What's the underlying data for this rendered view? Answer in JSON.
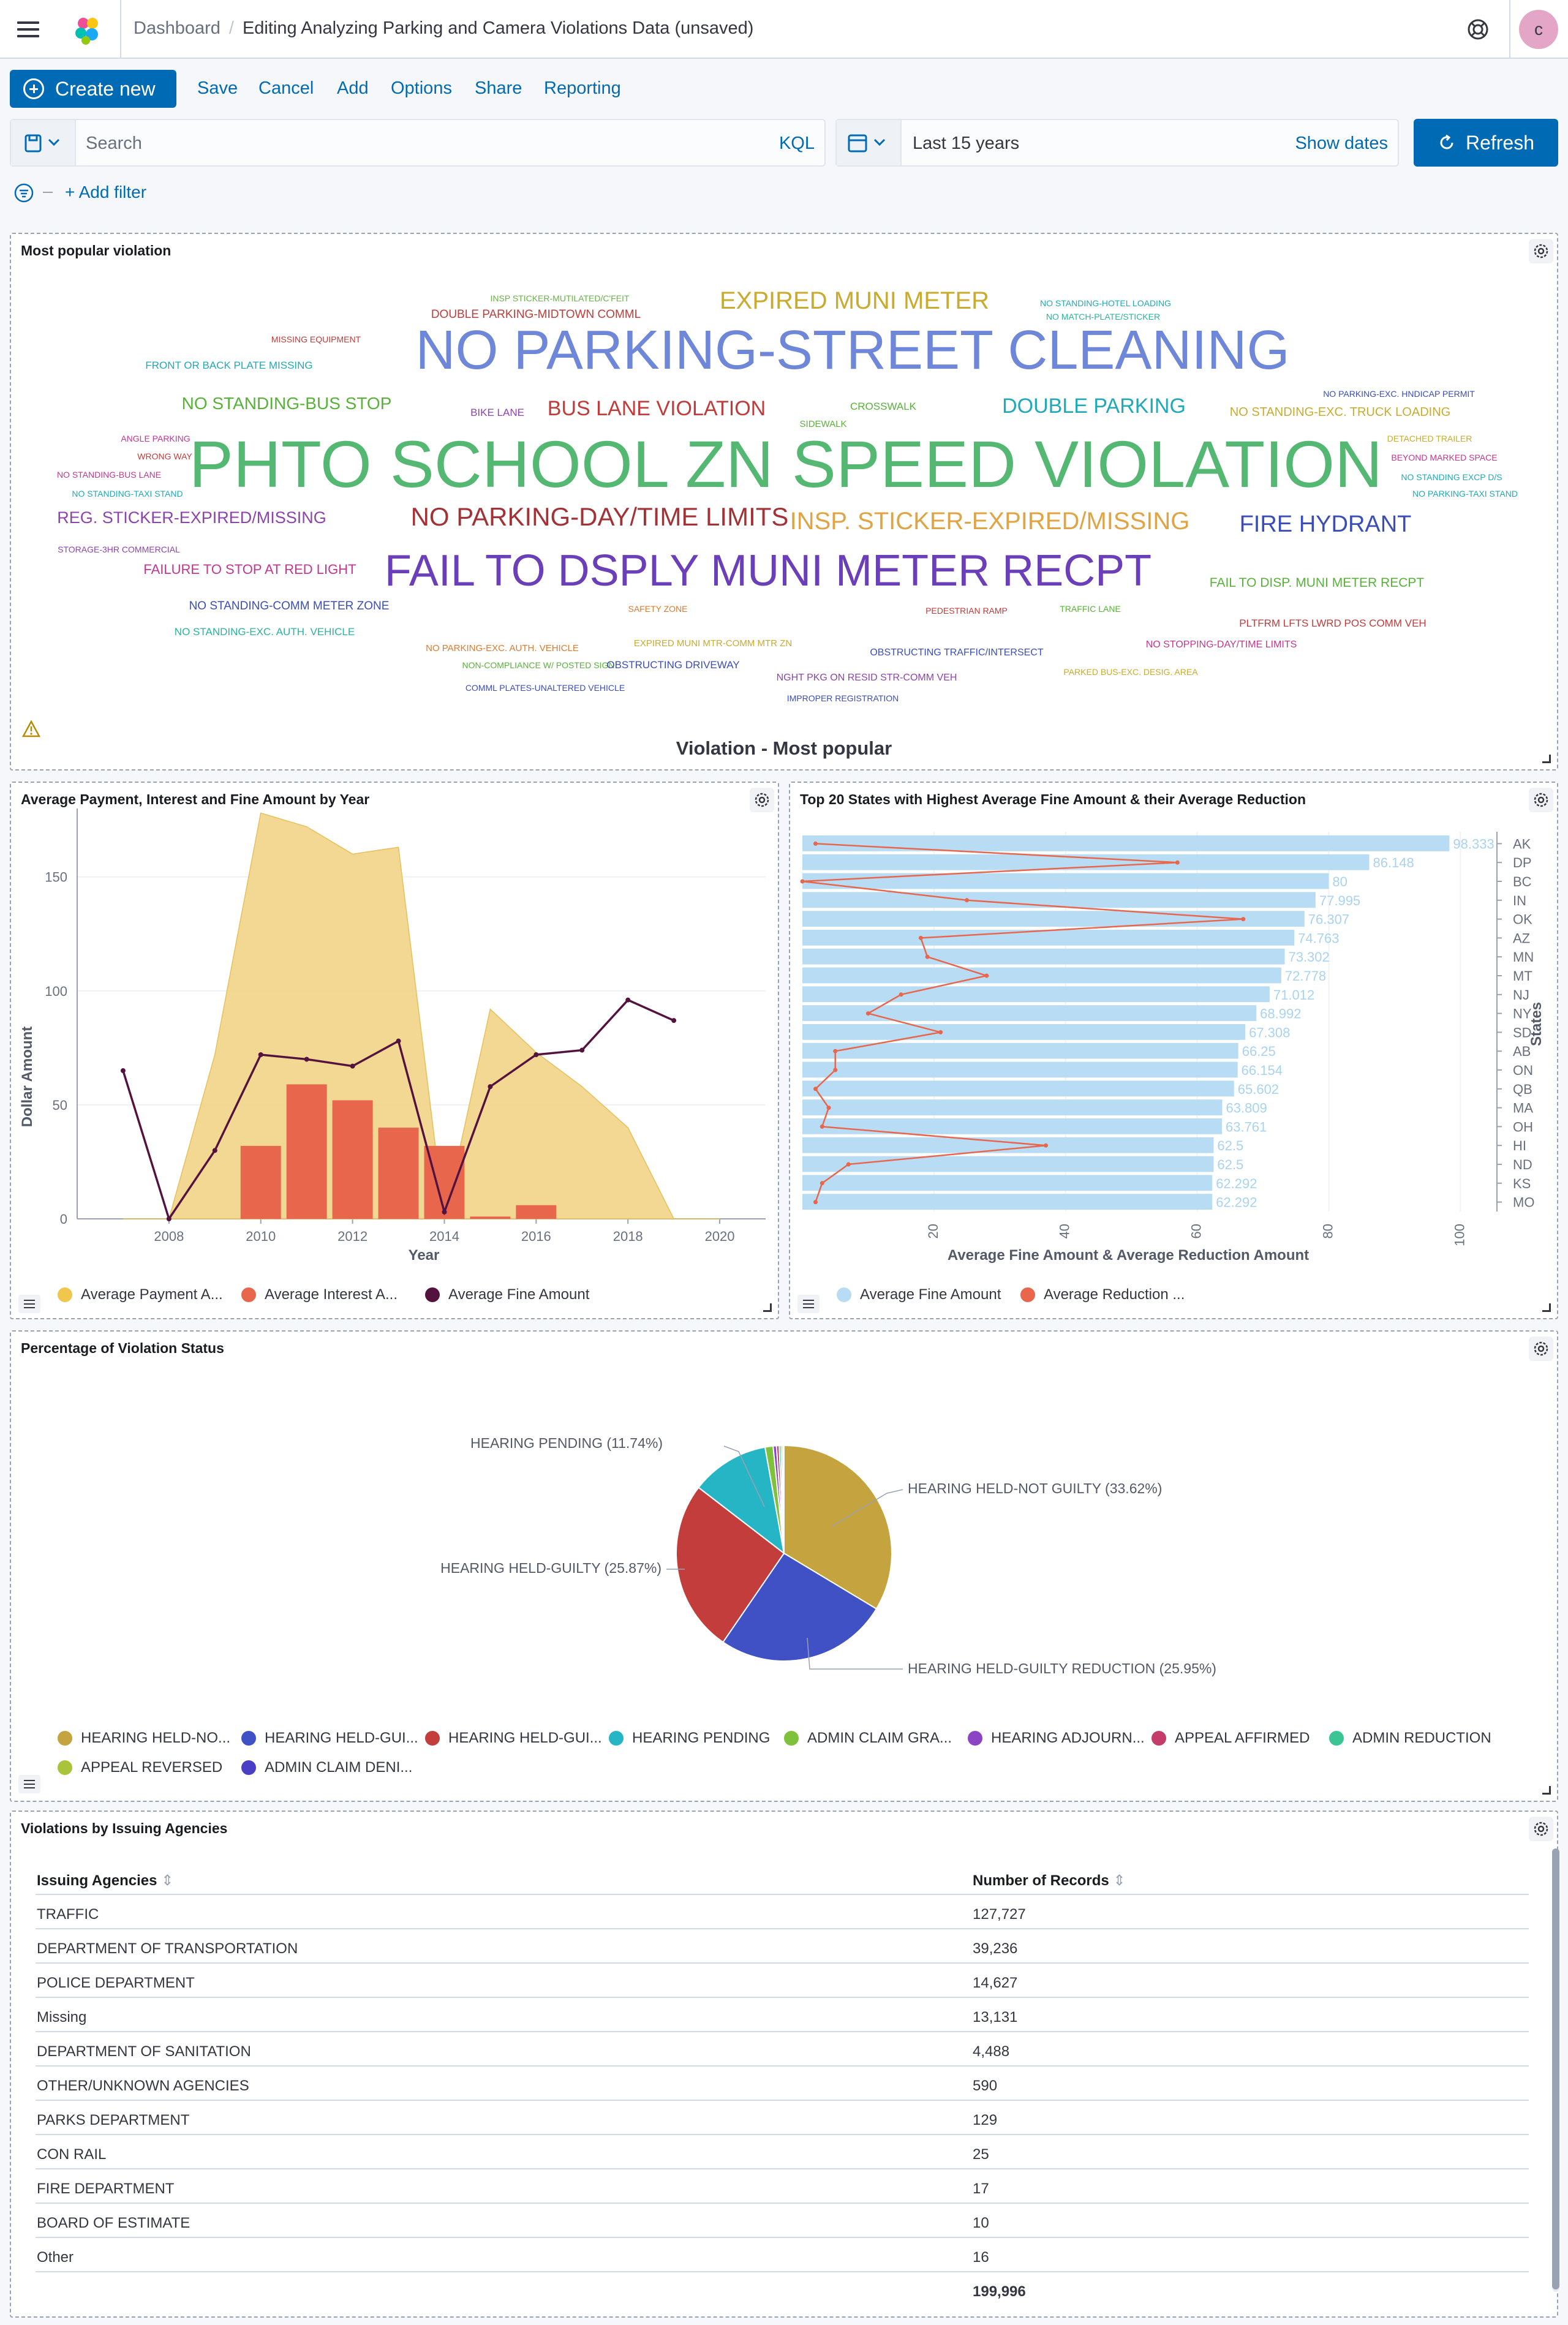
{
  "header": {
    "breadcrumb_root": "Dashboard",
    "breadcrumb_current": "Editing Analyzing Parking and Camera Violations Data (unsaved)",
    "avatar_initial": "c"
  },
  "menu": {
    "create_new": "Create new",
    "items": [
      "Save",
      "Cancel",
      "Add",
      "Options",
      "Share",
      "Reporting"
    ]
  },
  "query": {
    "search_placeholder": "Search",
    "language": "KQL",
    "time_range": "Last 15 years",
    "show_dates": "Show dates",
    "refresh": "Refresh",
    "add_filter": "+ Add filter"
  },
  "colors": {
    "primary": "#006bb4",
    "yellow": "#f1d486",
    "red": "#e7664c",
    "purple": "#54123f",
    "lightblue": "#b8dcf4"
  },
  "panels": {
    "wordcloud": {
      "title": "Most popular violation",
      "caption": "Violation - Most popular",
      "words": [
        {
          "text": "INSP STICKER-MUTILATED/C'FEIT",
          "size": 14,
          "color": "#6ab04c"
        },
        {
          "text": "DOUBLE PARKING-MIDTOWN COMML",
          "size": 19,
          "color": "#c23b3b"
        },
        {
          "text": "EXPIRED MUNI METER",
          "size": 40,
          "color": "#c9ab2f"
        },
        {
          "text": "NO STANDING-HOTEL LOADING",
          "size": 14,
          "color": "#20a9b8"
        },
        {
          "text": "NO MATCH-PLATE/STICKER",
          "size": 14,
          "color": "#2ab39d"
        },
        {
          "text": "MISSING EQUIPMENT",
          "size": 14,
          "color": "#c23b3b"
        },
        {
          "text": "NO PARKING-STREET CLEANING",
          "size": 90,
          "color": "#6f87d8"
        },
        {
          "text": "FRONT OR BACK PLATE MISSING",
          "size": 17,
          "color": "#20a9b8"
        },
        {
          "text": "NO STANDING-BUS STOP",
          "size": 28,
          "color": "#58b23a"
        },
        {
          "text": "BIKE LANE",
          "size": 17,
          "color": "#8e44ad"
        },
        {
          "text": "BUS LANE VIOLATION",
          "size": 34,
          "color": "#c23b3b"
        },
        {
          "text": "CROSSWALK",
          "size": 17,
          "color": "#58b23a"
        },
        {
          "text": "DOUBLE PARKING",
          "size": 34,
          "color": "#20a9b8"
        },
        {
          "text": "NO STANDING-EXC. TRUCK LOADING",
          "size": 20,
          "color": "#c9ab2f"
        },
        {
          "text": "NO PARKING-EXC. HNDICAP PERMIT",
          "size": 14,
          "color": "#3b4db8"
        },
        {
          "text": "SIDEWALK",
          "size": 15,
          "color": "#58b23a"
        },
        {
          "text": "ANGLE PARKING",
          "size": 14,
          "color": "#c2368f"
        },
        {
          "text": "DETACHED TRAILER",
          "size": 14,
          "color": "#c9ab2f"
        },
        {
          "text": "WRONG WAY",
          "size": 14,
          "color": "#c23b3b"
        },
        {
          "text": "PHTO SCHOOL ZN SPEED VIOLATION",
          "size": 108,
          "color": "#54b873"
        },
        {
          "text": "BEYOND MARKED SPACE",
          "size": 14,
          "color": "#c2368f"
        },
        {
          "text": "NO STANDING-BUS LANE",
          "size": 14,
          "color": "#c2368f"
        },
        {
          "text": "NO STANDING EXCP D/S",
          "size": 14,
          "color": "#20a9b8"
        },
        {
          "text": "NO STANDING-TAXI STAND",
          "size": 14,
          "color": "#20a9b8"
        },
        {
          "text": "NO PARKING-TAXI STAND",
          "size": 14,
          "color": "#20a9b8"
        },
        {
          "text": "REG. STICKER-EXPIRED/MISSING",
          "size": 27,
          "color": "#8e44ad"
        },
        {
          "text": "NO PARKING-DAY/TIME LIMITS",
          "size": 42,
          "color": "#a33236"
        },
        {
          "text": "INSP. STICKER-EXPIRED/MISSING",
          "size": 40,
          "color": "#e0a445"
        },
        {
          "text": "FIRE HYDRANT",
          "size": 38,
          "color": "#3b4db8"
        },
        {
          "text": "STORAGE-3HR COMMERCIAL",
          "size": 14,
          "color": "#8e44ad"
        },
        {
          "text": "FAILURE TO STOP AT RED LIGHT",
          "size": 22,
          "color": "#c2368f"
        },
        {
          "text": "FAIL TO DSPLY MUNI METER RECPT",
          "size": 72,
          "color": "#6a3fb8"
        },
        {
          "text": "FAIL TO DISP. MUNI METER RECPT",
          "size": 21,
          "color": "#58b23a"
        },
        {
          "text": "NO STANDING-COMM METER ZONE",
          "size": 19,
          "color": "#3b4db8"
        },
        {
          "text": "SAFETY ZONE",
          "size": 14,
          "color": "#e07a2f"
        },
        {
          "text": "PEDESTRIAN RAMP",
          "size": 14,
          "color": "#c23b3b"
        },
        {
          "text": "TRAFFIC LANE",
          "size": 14,
          "color": "#58b23a"
        },
        {
          "text": "PLTFRM LFTS LWRD POS COMM VEH",
          "size": 17,
          "color": "#c23b3b"
        },
        {
          "text": "NO STANDING-EXC. AUTH. VEHICLE",
          "size": 17,
          "color": "#2ab39d"
        },
        {
          "text": "NO PARKING-EXC. AUTH. VEHICLE",
          "size": 15,
          "color": "#e07a2f"
        },
        {
          "text": "EXPIRED MUNI MTR-COMM MTR ZN",
          "size": 15,
          "color": "#c9ab2f"
        },
        {
          "text": "OBSTRUCTING TRAFFIC/INTERSECT",
          "size": 16,
          "color": "#3b4db8"
        },
        {
          "text": "NO STOPPING-DAY/TIME LIMITS",
          "size": 16,
          "color": "#c2368f"
        },
        {
          "text": "NON-COMPLIANCE W/ POSTED SIGN",
          "size": 14,
          "color": "#58b23a"
        },
        {
          "text": "OBSTRUCTING DRIVEWAY",
          "size": 17,
          "color": "#3b4db8"
        },
        {
          "text": "NGHT PKG ON RESID STR-COMM VEH",
          "size": 16,
          "color": "#8e44ad"
        },
        {
          "text": "PARKED BUS-EXC. DESIG. AREA",
          "size": 14,
          "color": "#c9ab2f"
        },
        {
          "text": "COMML PLATES-UNALTERED VEHICLE",
          "size": 14,
          "color": "#3b4db8"
        },
        {
          "text": "IMPROPER REGISTRATION",
          "size": 14,
          "color": "#3b4db8"
        }
      ]
    },
    "yearly": {
      "title": "Average Payment, Interest and Fine Amount by Year",
      "xlabel": "Year",
      "ylabel": "Dollar Amount",
      "legend": [
        "Average Payment A...",
        "Average Interest A...",
        "Average Fine Amount"
      ]
    },
    "states": {
      "title": "Top 20 States with Highest Average Fine Amount & their Average Reduction",
      "xlabel": "Average Fine Amount & Average Reduction Amount",
      "ylabel": "States",
      "legend": [
        "Average Fine Amount",
        "Average Reduction ..."
      ]
    },
    "status": {
      "title": "Percentage of Violation Status",
      "legend": [
        "HEARING HELD-NO...",
        "HEARING HELD-GUI...",
        "HEARING HELD-GUI...",
        "HEARING PENDING",
        "ADMIN CLAIM GRA...",
        "HEARING ADJOURN...",
        "APPEAL AFFIRMED",
        "ADMIN REDUCTION",
        "APPEAL REVERSED",
        "ADMIN CLAIM DENI..."
      ],
      "legend_colors": [
        "#c5a43f",
        "#3f51c4",
        "#c43d3d",
        "#25b5c4",
        "#7fc13b",
        "#8c44c4",
        "#c43d6a",
        "#3bc494",
        "#a9c43b",
        "#4a3fc4"
      ]
    },
    "agencies": {
      "title": "Violations by Issuing Agencies",
      "col_agency": "Issuing Agencies",
      "col_records": "Number of Records",
      "rows": [
        [
          "TRAFFIC",
          "127,727"
        ],
        [
          "DEPARTMENT OF TRANSPORTATION",
          "39,236"
        ],
        [
          "POLICE DEPARTMENT",
          "14,627"
        ],
        [
          "Missing",
          "13,131"
        ],
        [
          "DEPARTMENT OF SANITATION",
          "4,488"
        ],
        [
          "OTHER/UNKNOWN AGENCIES",
          "590"
        ],
        [
          "PARKS DEPARTMENT",
          "129"
        ],
        [
          "CON RAIL",
          "25"
        ],
        [
          "FIRE DEPARTMENT",
          "17"
        ],
        [
          "BOARD OF ESTIMATE",
          "10"
        ],
        [
          "Other",
          "16"
        ]
      ],
      "total": "199,996"
    }
  },
  "chart_data": [
    {
      "type": "area",
      "x": [
        2007,
        2008,
        2009,
        2010,
        2011,
        2012,
        2013,
        2014,
        2015,
        2016,
        2017,
        2018,
        2019,
        2020
      ],
      "xlim": [
        2006,
        2021
      ],
      "ylim": [
        0,
        180
      ],
      "yticks": [
        0,
        50,
        100,
        150
      ],
      "xticks": [
        2008,
        2010,
        2012,
        2014,
        2016,
        2018,
        2020
      ],
      "series": [
        {
          "name": "Average Payment A...",
          "kind": "area",
          "color": "#f1d486",
          "x": [
            2007,
            2008,
            2009,
            2010,
            2011,
            2012,
            2013,
            2014,
            2015,
            2016,
            2017,
            2018,
            2019,
            2020
          ],
          "values": [
            0,
            0,
            72,
            178,
            172,
            160,
            163,
            0,
            92,
            73,
            58,
            40,
            0,
            0
          ]
        },
        {
          "name": "Average Interest A...",
          "kind": "bar",
          "color": "#e7664c",
          "x": [
            2010,
            2011,
            2012,
            2013,
            2014,
            2015,
            2016
          ],
          "values": [
            32,
            59,
            52,
            40,
            32,
            1,
            6
          ]
        },
        {
          "name": "Average Fine Amount",
          "kind": "line",
          "color": "#54123f",
          "x": [
            2007,
            2008,
            2009,
            2010,
            2011,
            2012,
            2013,
            2014,
            2015,
            2016,
            2017,
            2018,
            2019
          ],
          "values": [
            65,
            0,
            30,
            72,
            70,
            67,
            78,
            3,
            58,
            72,
            74,
            96,
            87
          ]
        }
      ]
    },
    {
      "type": "bar",
      "orientation": "horizontal",
      "categories": [
        "AK",
        "DP",
        "BC",
        "IN",
        "OK",
        "AZ",
        "MN",
        "MT",
        "NJ",
        "NY",
        "SD",
        "AB",
        "ON",
        "QB",
        "MA",
        "OH",
        "HI",
        "ND",
        "KS",
        "MO"
      ],
      "xlim": [
        0,
        105
      ],
      "xticks": [
        20,
        40,
        60,
        80,
        100
      ],
      "series": [
        {
          "name": "Average Fine Amount",
          "kind": "bar",
          "color": "#b8dcf4",
          "values": [
            98.333,
            86.148,
            80,
            77.995,
            76.307,
            74.763,
            73.302,
            72.778,
            71.012,
            68.992,
            67.308,
            66.25,
            66.154,
            65.602,
            63.809,
            63.761,
            62.5,
            62.5,
            62.292,
            62.292
          ]
        },
        {
          "name": "Average Reduction ...",
          "kind": "line",
          "color": "#e7664c",
          "values": [
            2,
            57,
            0,
            25,
            67,
            18,
            19,
            28,
            15,
            10,
            21,
            5,
            5,
            2,
            4,
            3,
            37,
            7,
            3,
            2
          ]
        }
      ]
    },
    {
      "type": "pie",
      "labels": [
        "HEARING HELD-NOT GUILTY",
        "HEARING HELD-GUILTY REDUCTION",
        "HEARING HELD-GUILTY",
        "HEARING PENDING",
        "ADMIN CLAIM GRA...",
        "HEARING ADJOURN...",
        "APPEAL AFFIRMED",
        "ADMIN REDUCTION",
        "APPEAL REVERSED",
        "ADMIN CLAIM DENI..."
      ],
      "values": [
        33.62,
        25.95,
        25.87,
        11.74,
        1.2,
        0.5,
        0.4,
        0.3,
        0.25,
        0.17
      ],
      "colors": [
        "#c5a43f",
        "#3f51c4",
        "#c43d3d",
        "#25b5c4",
        "#7fc13b",
        "#8c44c4",
        "#c43d6a",
        "#3bc494",
        "#a9c43b",
        "#4a3fc4"
      ],
      "callouts": [
        "HEARING PENDING (11.74%)",
        "HEARING HELD-NOT GUILTY (33.62%)",
        "HEARING HELD-GUILTY (25.87%)",
        "HEARING HELD-GUILTY REDUCTION (25.95%)"
      ]
    }
  ]
}
